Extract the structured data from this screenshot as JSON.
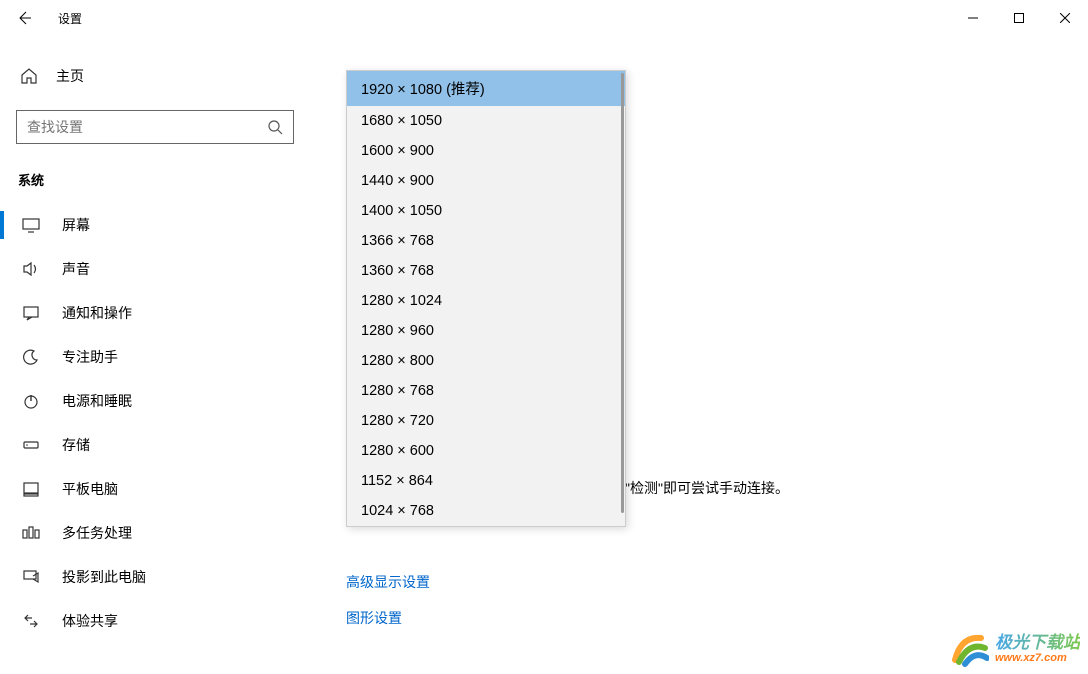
{
  "titlebar": {
    "title": "设置"
  },
  "sidebar": {
    "home_label": "主页",
    "search_placeholder": "查找设置",
    "category": "系统",
    "items": [
      {
        "icon": "display",
        "label": "屏幕",
        "active": true
      },
      {
        "icon": "sound",
        "label": "声音"
      },
      {
        "icon": "notify",
        "label": "通知和操作"
      },
      {
        "icon": "focus",
        "label": "专注助手"
      },
      {
        "icon": "power",
        "label": "电源和睡眠"
      },
      {
        "icon": "storage",
        "label": "存储"
      },
      {
        "icon": "tablet",
        "label": "平板电脑"
      },
      {
        "icon": "multitask",
        "label": "多任务处理"
      },
      {
        "icon": "project",
        "label": "投影到此电脑"
      },
      {
        "icon": "share",
        "label": "体验共享"
      }
    ]
  },
  "content": {
    "dropdown_options": [
      "1920 × 1080 (推荐)",
      "1680 × 1050",
      "1600 × 900",
      "1440 × 900",
      "1400 × 1050",
      "1366 × 768",
      "1360 × 768",
      "1280 × 1024",
      "1280 × 960",
      "1280 × 800",
      "1280 × 768",
      "1280 × 720",
      "1280 × 600",
      "1152 × 864",
      "1024 × 768"
    ],
    "detect_text": "\"检测\"即可尝试手动连接。",
    "link_advanced": "高级显示设置",
    "link_graphics": "图形设置"
  },
  "watermark": {
    "cn": "极光下载站",
    "url": "www.xz7.com"
  }
}
